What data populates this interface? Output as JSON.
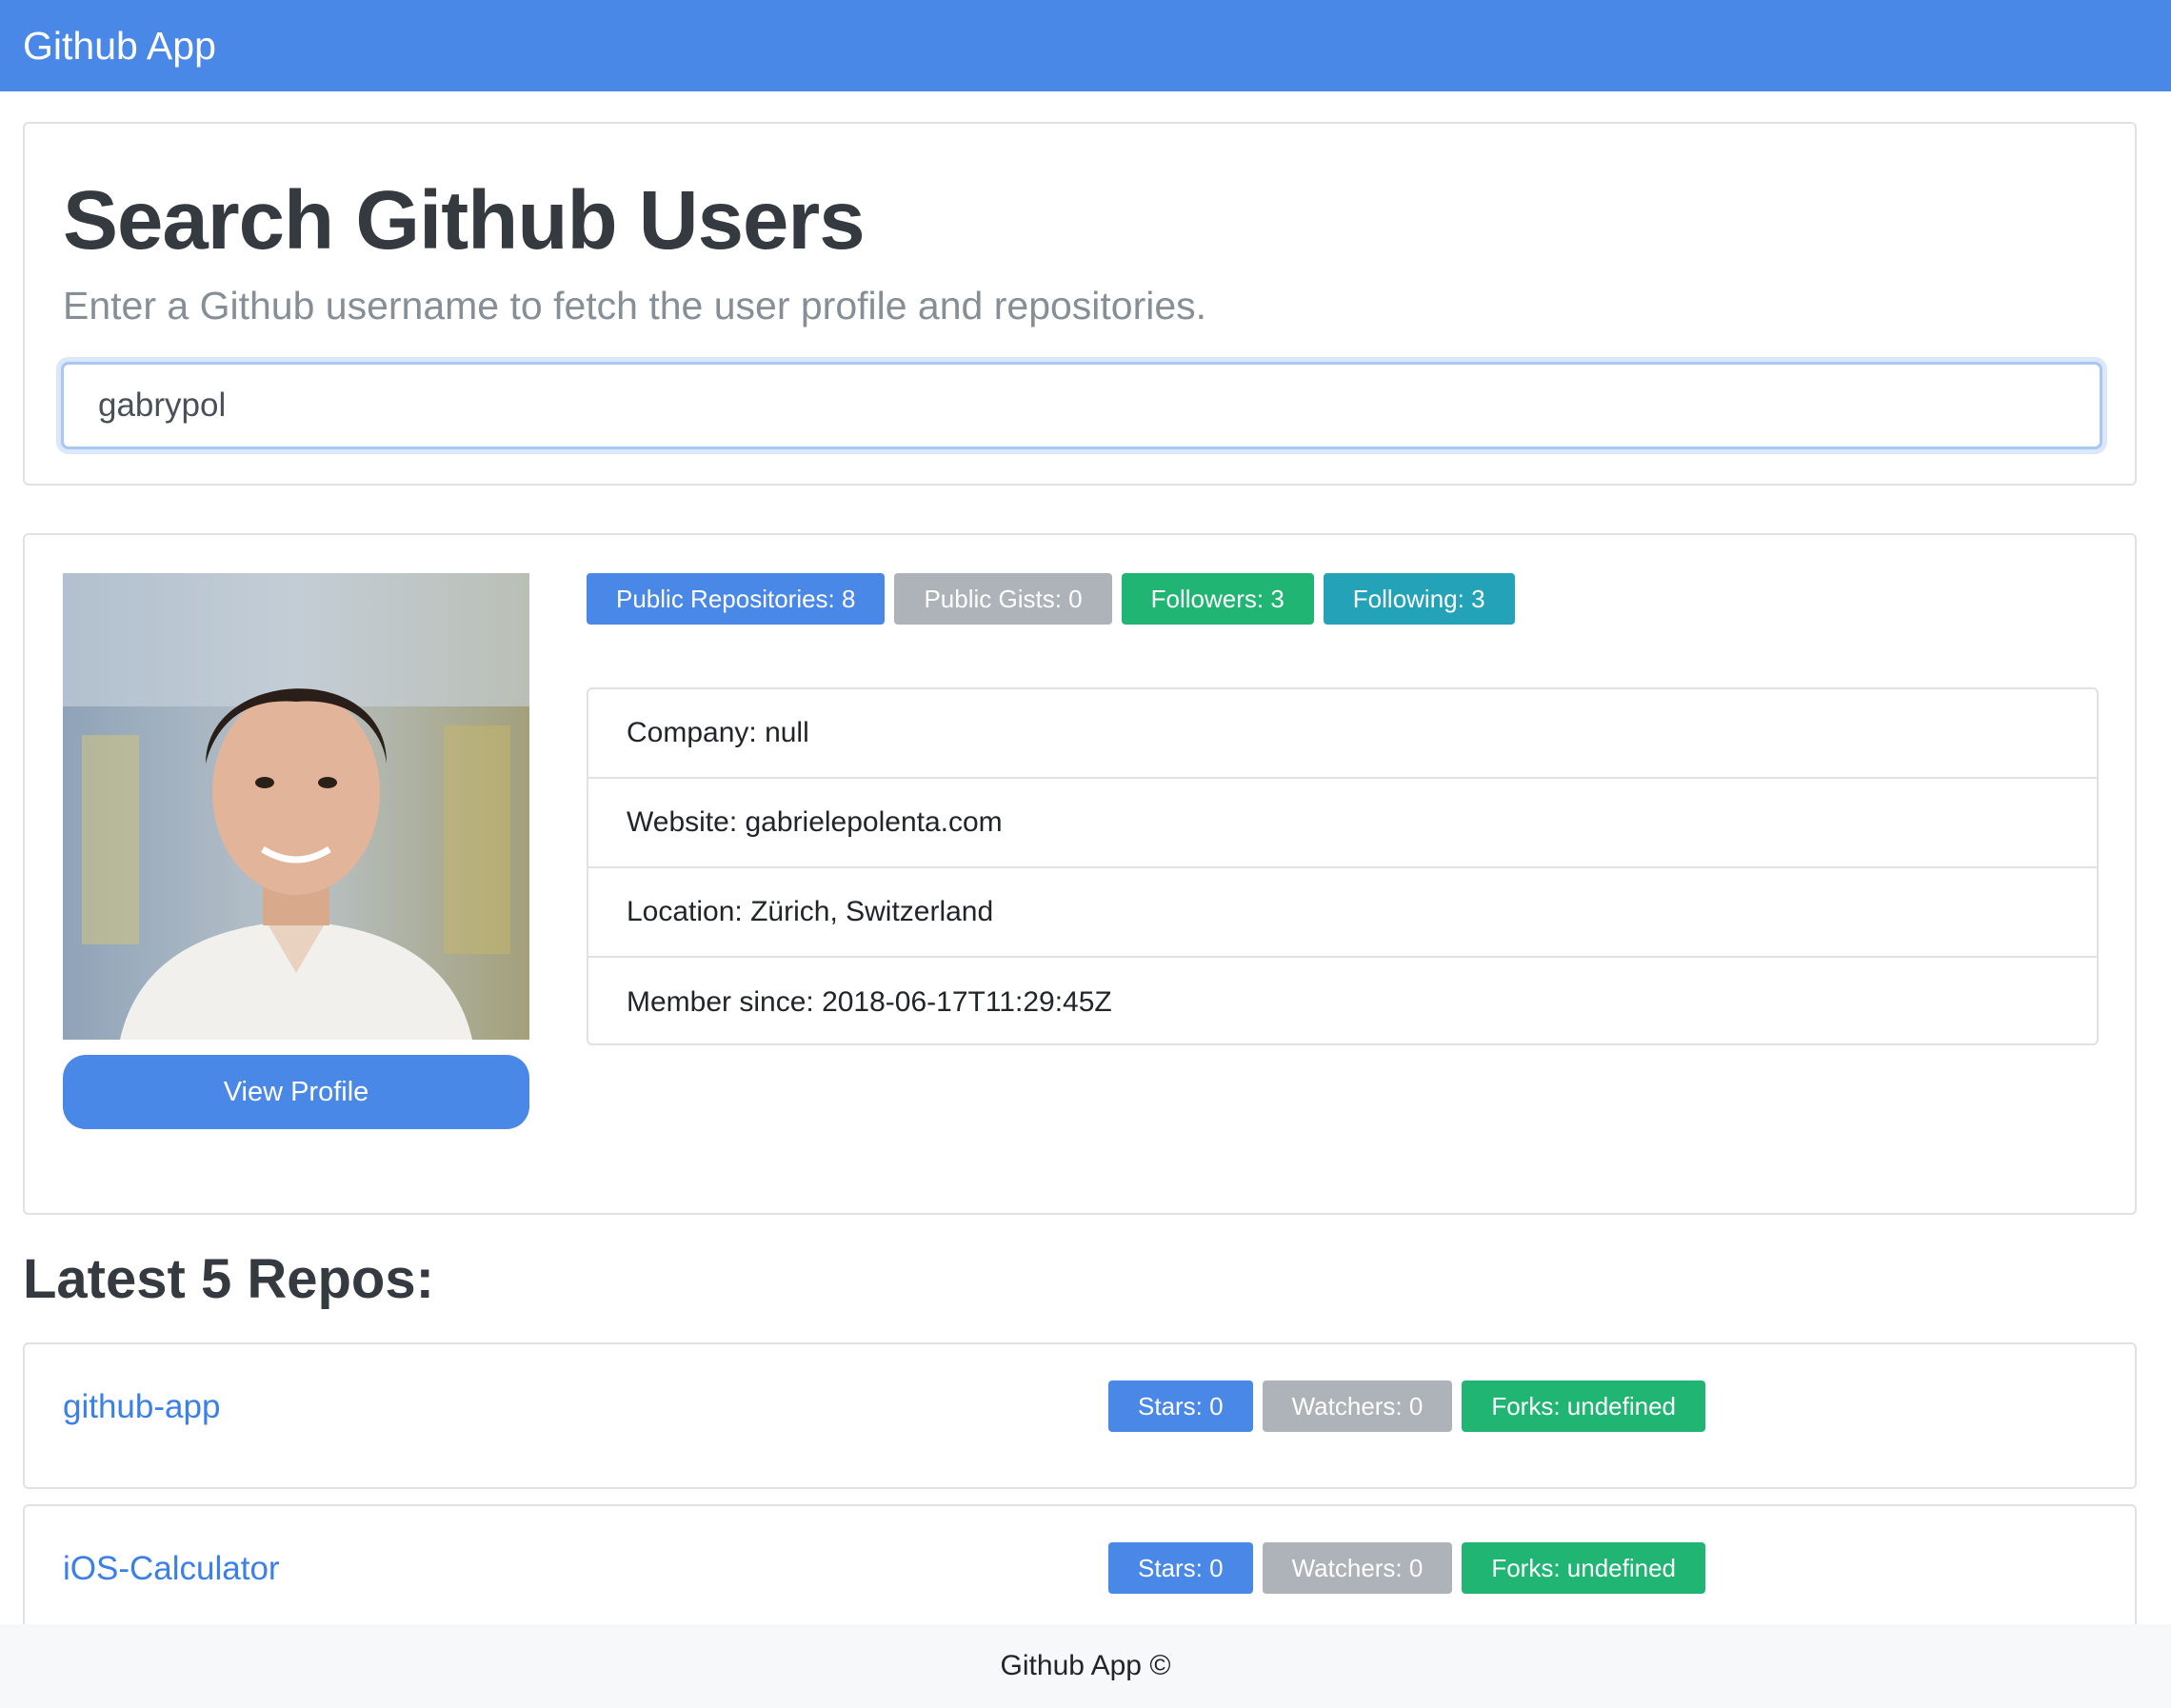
{
  "navbar": {
    "brand": "Github App"
  },
  "search": {
    "title": "Search Github Users",
    "lead": "Enter a Github username to fetch the user profile and repositories.",
    "input_value": "gabrypol"
  },
  "profile": {
    "view_profile_label": "View Profile",
    "badges": {
      "repos": "Public Repositories: 8",
      "gists": "Public Gists: 0",
      "followers": "Followers: 3",
      "following": "Following: 3"
    },
    "details": [
      "Company: null",
      "Website: gabrielepolenta.com",
      "Location: Zürich, Switzerland",
      "Member since: 2018-06-17T11:29:45Z"
    ]
  },
  "repos": {
    "heading": "Latest 5 Repos:",
    "items": [
      {
        "name": "github-app",
        "stars": "Stars: 0",
        "watchers": "Watchers: 0",
        "forks": "Forks: undefined"
      },
      {
        "name": "iOS-Calculator",
        "stars": "Stars: 0",
        "watchers": "Watchers: 0",
        "forks": "Forks: undefined"
      }
    ]
  },
  "footer": {
    "text": "Github App ©"
  },
  "colors": {
    "primary": "#4a88e8",
    "secondary": "#adb3b9",
    "success": "#21b573",
    "info": "#23a2b8"
  }
}
